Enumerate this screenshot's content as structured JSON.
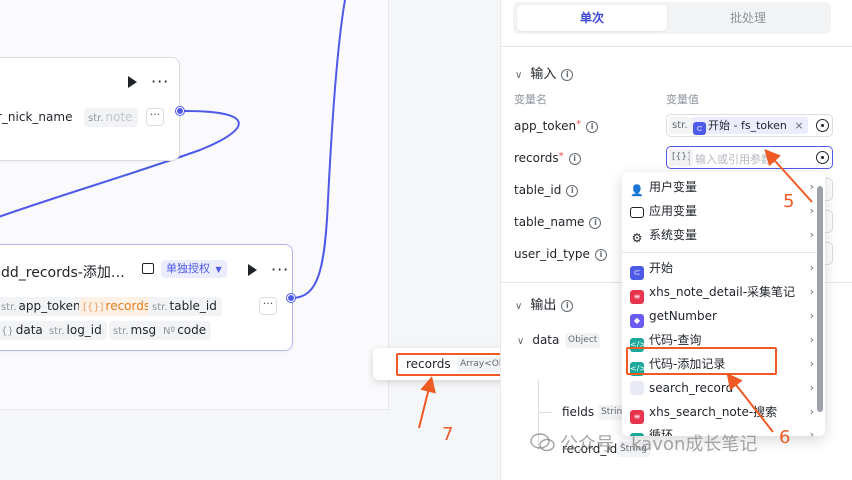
{
  "canvas": {
    "node1": {
      "chips": [
        {
          "type": "",
          "label": "r_nick_name"
        },
        {
          "type": "str.",
          "label": "note"
        }
      ],
      "more": "···"
    },
    "node2": {
      "title": "dd_records-添加…",
      "auth_tag": "单独授权",
      "inputs": [
        {
          "type": "str.",
          "label": "app_token"
        },
        {
          "type": "[{}]",
          "label": "records"
        },
        {
          "type": "str.",
          "label": "table_id"
        }
      ],
      "outputs": [
        {
          "type": "{}",
          "label": "data"
        },
        {
          "type": "str.",
          "label": "log_id"
        },
        {
          "type": "str.",
          "label": "msg"
        },
        {
          "type": "Nº",
          "label": "code"
        }
      ],
      "more": "···"
    },
    "records_popup": {
      "name": "records",
      "type": "Array<Object>"
    }
  },
  "panel": {
    "tabs": {
      "active": "单次",
      "inactive": "批处理"
    },
    "input_section": "输入",
    "col_name": "变量名",
    "col_value": "变量值",
    "fields": [
      {
        "label": "app_token",
        "required": true,
        "type": "str.",
        "value": "开始 - fs_token"
      },
      {
        "label": "records",
        "required": true,
        "type": "[{}]",
        "placeholder": "输入或引用参数..."
      },
      {
        "label": "table_id",
        "required": false
      },
      {
        "label": "table_name",
        "required": false
      },
      {
        "label": "user_id_type",
        "required": false
      }
    ],
    "output_section": "输出",
    "output_tree": [
      {
        "label": "data",
        "type": "Object"
      },
      {
        "label": "fields",
        "type": "String"
      },
      {
        "label": "record_id",
        "type": "String"
      }
    ]
  },
  "dropdown": {
    "items": [
      {
        "label": "用户变量",
        "icon": "user-icon"
      },
      {
        "label": "应用变量",
        "icon": "folder-icon"
      },
      {
        "label": "系统变量",
        "icon": "gear-icon"
      },
      {
        "label": "开始",
        "icon": "start-icon"
      },
      {
        "label": "xhs_note_detail-采集笔记",
        "icon": "xhs-icon"
      },
      {
        "label": "getNumber",
        "icon": "cube-icon"
      },
      {
        "label": "代码-查询",
        "icon": "code-icon"
      },
      {
        "label": "代码-添加记录",
        "icon": "code-icon"
      },
      {
        "label": "search_record",
        "icon": "search-record-icon"
      },
      {
        "label": "xhs_search_note-搜索",
        "icon": "xhs-icon"
      },
      {
        "label": "循环",
        "icon": "loop-icon"
      }
    ]
  },
  "annotations": {
    "step5": "5",
    "step6": "6",
    "step7": "7"
  },
  "watermark": "公众号 · kavon成长笔记",
  "colors": {
    "accent": "#4e5ae8",
    "annotation": "#f05a24",
    "required": "#f54a45"
  }
}
